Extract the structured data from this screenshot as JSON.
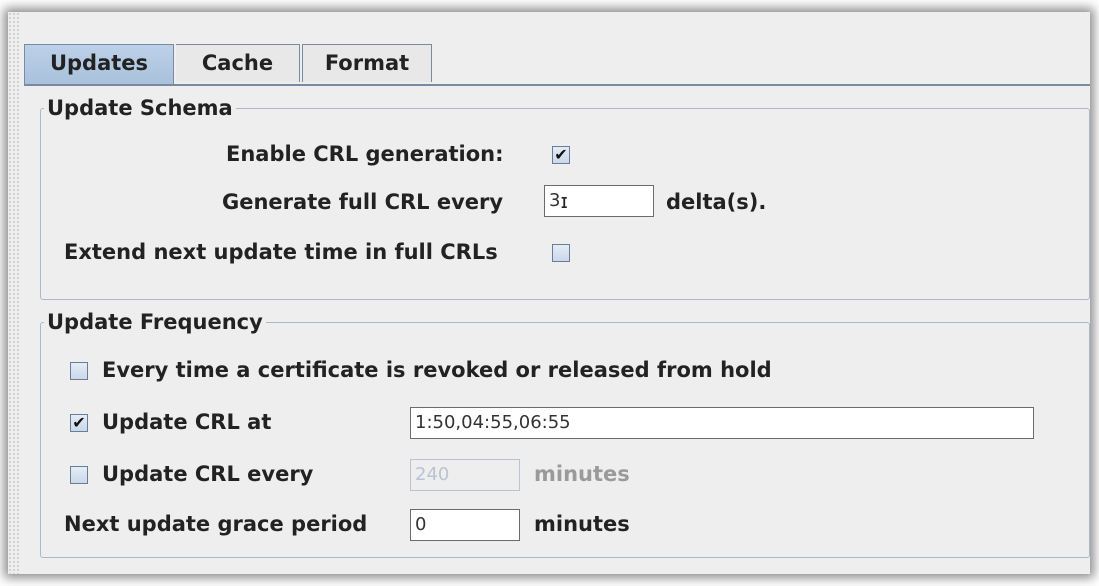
{
  "tabs": [
    {
      "label": "Updates",
      "active": true
    },
    {
      "label": "Cache",
      "active": false
    },
    {
      "label": "Format",
      "active": false
    }
  ],
  "update_schema": {
    "title": "Update Schema",
    "enable_crl_label": "Enable CRL generation:",
    "enable_crl_checked": true,
    "full_crl_label": "Generate full CRL every",
    "full_crl_value": "3",
    "full_crl_unit": "delta(s).",
    "extend_label": "Extend next update time in full CRLs",
    "extend_checked": false
  },
  "update_frequency": {
    "title": "Update Frequency",
    "every_revoke_label": "Every time a certificate is revoked or released from hold",
    "every_revoke_checked": false,
    "update_at_label": "Update CRL at",
    "update_at_checked": true,
    "update_at_value": "1:50,04:55,06:55",
    "update_every_label": "Update CRL every",
    "update_every_checked": false,
    "update_every_value": "240",
    "update_every_unit": "minutes",
    "grace_label": "Next update grace period",
    "grace_value": "0",
    "grace_unit": "minutes"
  },
  "check_glyph": "✔"
}
